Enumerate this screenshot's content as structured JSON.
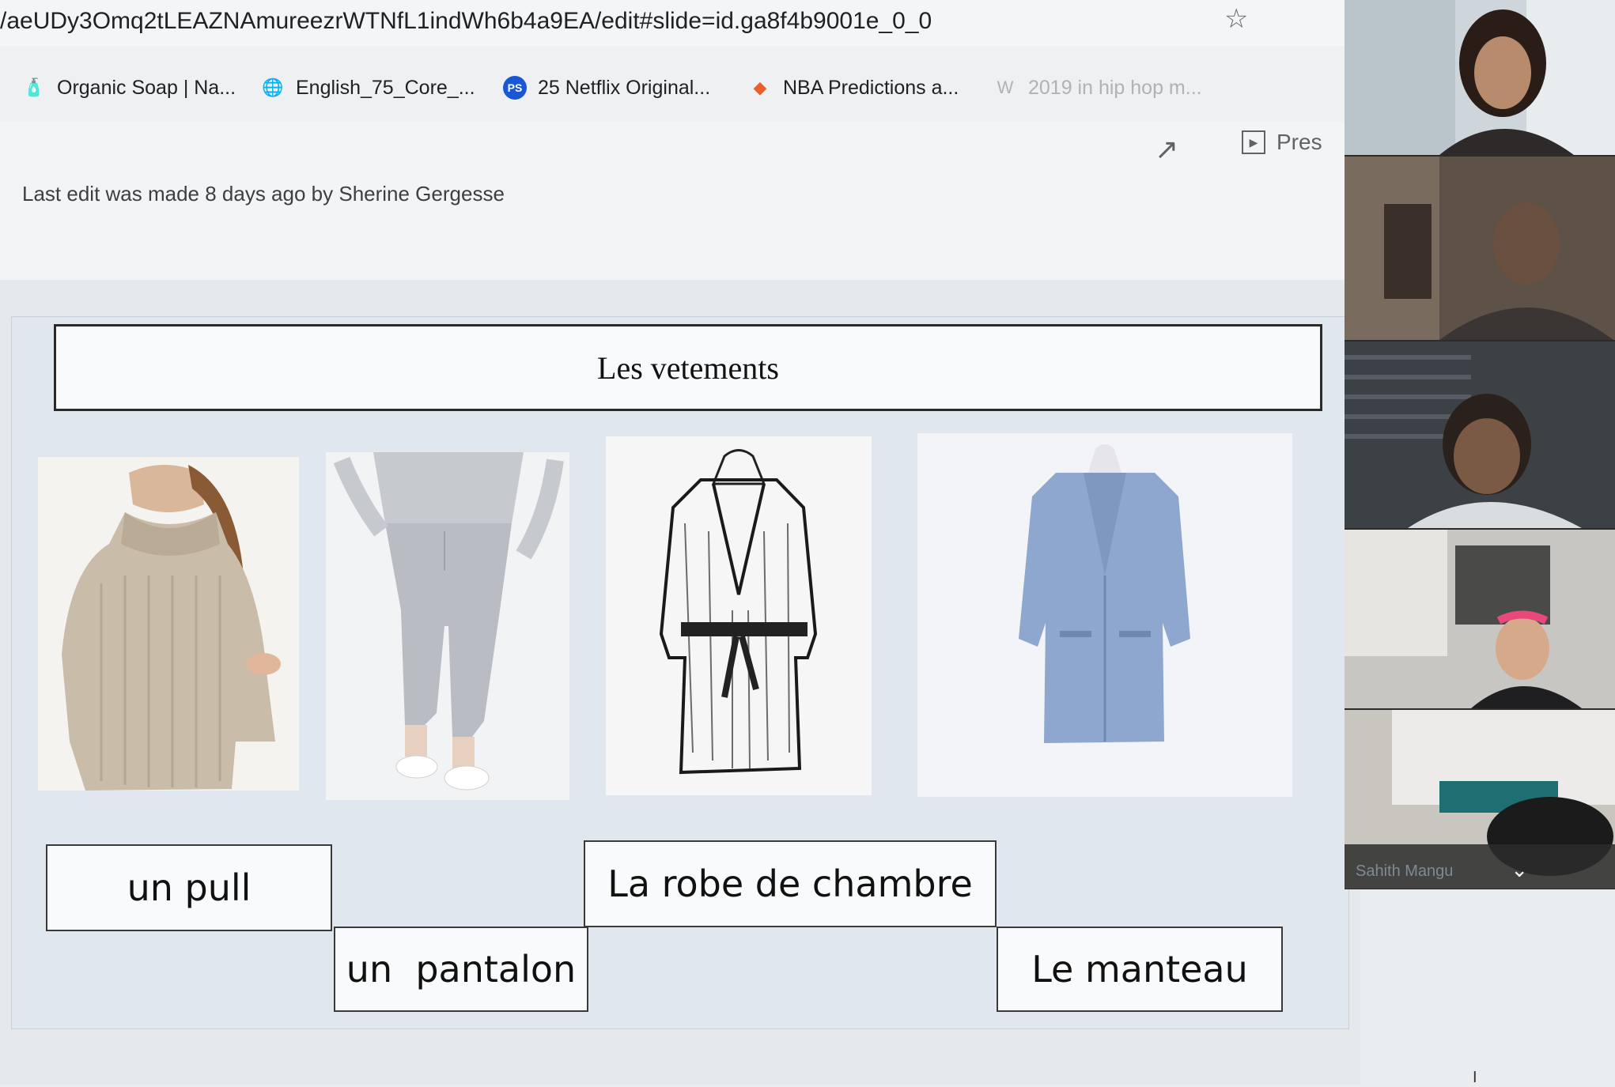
{
  "browser": {
    "url": "/aeUDy3Omq2tLEAZNAmureezrWTNfL1indWh6b4a9EA/edit#slide=id.ga8f4b9001e_0_0",
    "bookmarks": [
      {
        "label": "Organic Soap | Na...",
        "icon": "soap-icon"
      },
      {
        "label": "English_75_Core_...",
        "icon": "globe-icon"
      },
      {
        "label": "25 Netflix Original...",
        "icon": "ps-icon"
      },
      {
        "label": "NBA Predictions a...",
        "icon": "nba-icon"
      },
      {
        "label": "2019 in hip hop m...",
        "icon": "wikipedia-icon"
      }
    ]
  },
  "slides": {
    "last_edit": "Last edit was made 8 days ago by Sherine Gergesse",
    "present_label": "Pres"
  },
  "slide": {
    "title": "Les vetements",
    "images": [
      {
        "name": "sweater-photo",
        "alt": "turtleneck sweater"
      },
      {
        "name": "pants-photo",
        "alt": "grey jogger pants"
      },
      {
        "name": "robe-photo",
        "alt": "bathrobe sketch"
      },
      {
        "name": "coat-photo",
        "alt": "blue coat"
      }
    ],
    "labels": {
      "pull": "un pull",
      "pantalon": "un  pantalon",
      "robe": "La robe de chambre",
      "manteau": "Le manteau"
    }
  },
  "call": {
    "participant_name": "Sahith Mangu"
  },
  "colors": {
    "coat": "#8ea7cf",
    "sweater": "#c9bca8",
    "pants": "#b9bcc2"
  }
}
